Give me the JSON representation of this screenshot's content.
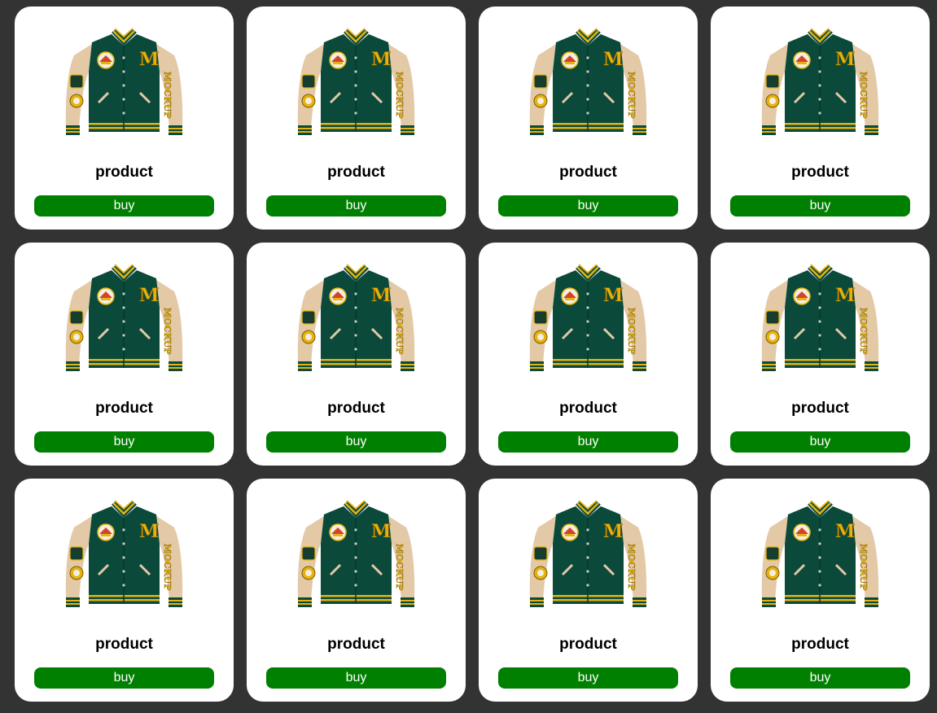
{
  "colors": {
    "background": "#333333",
    "card": "#ffffff",
    "button": "#008000",
    "button_text": "#ffffff",
    "jacket_body": "#0b4a3a",
    "jacket_sleeves": "#e3c9a6",
    "jacket_trim": "#e7b20f"
  },
  "products": [
    {
      "name": "product",
      "buy_label": "buy",
      "image_icon": "varsity-jacket-image"
    },
    {
      "name": "product",
      "buy_label": "buy",
      "image_icon": "varsity-jacket-image"
    },
    {
      "name": "product",
      "buy_label": "buy",
      "image_icon": "varsity-jacket-image"
    },
    {
      "name": "product",
      "buy_label": "buy",
      "image_icon": "varsity-jacket-image"
    },
    {
      "name": "product",
      "buy_label": "buy",
      "image_icon": "varsity-jacket-image"
    },
    {
      "name": "product",
      "buy_label": "buy",
      "image_icon": "varsity-jacket-image"
    },
    {
      "name": "product",
      "buy_label": "buy",
      "image_icon": "varsity-jacket-image"
    },
    {
      "name": "product",
      "buy_label": "buy",
      "image_icon": "varsity-jacket-image"
    },
    {
      "name": "product",
      "buy_label": "buy",
      "image_icon": "varsity-jacket-image"
    },
    {
      "name": "product",
      "buy_label": "buy",
      "image_icon": "varsity-jacket-image"
    },
    {
      "name": "product",
      "buy_label": "buy",
      "image_icon": "varsity-jacket-image"
    },
    {
      "name": "product",
      "buy_label": "buy",
      "image_icon": "varsity-jacket-image"
    }
  ]
}
